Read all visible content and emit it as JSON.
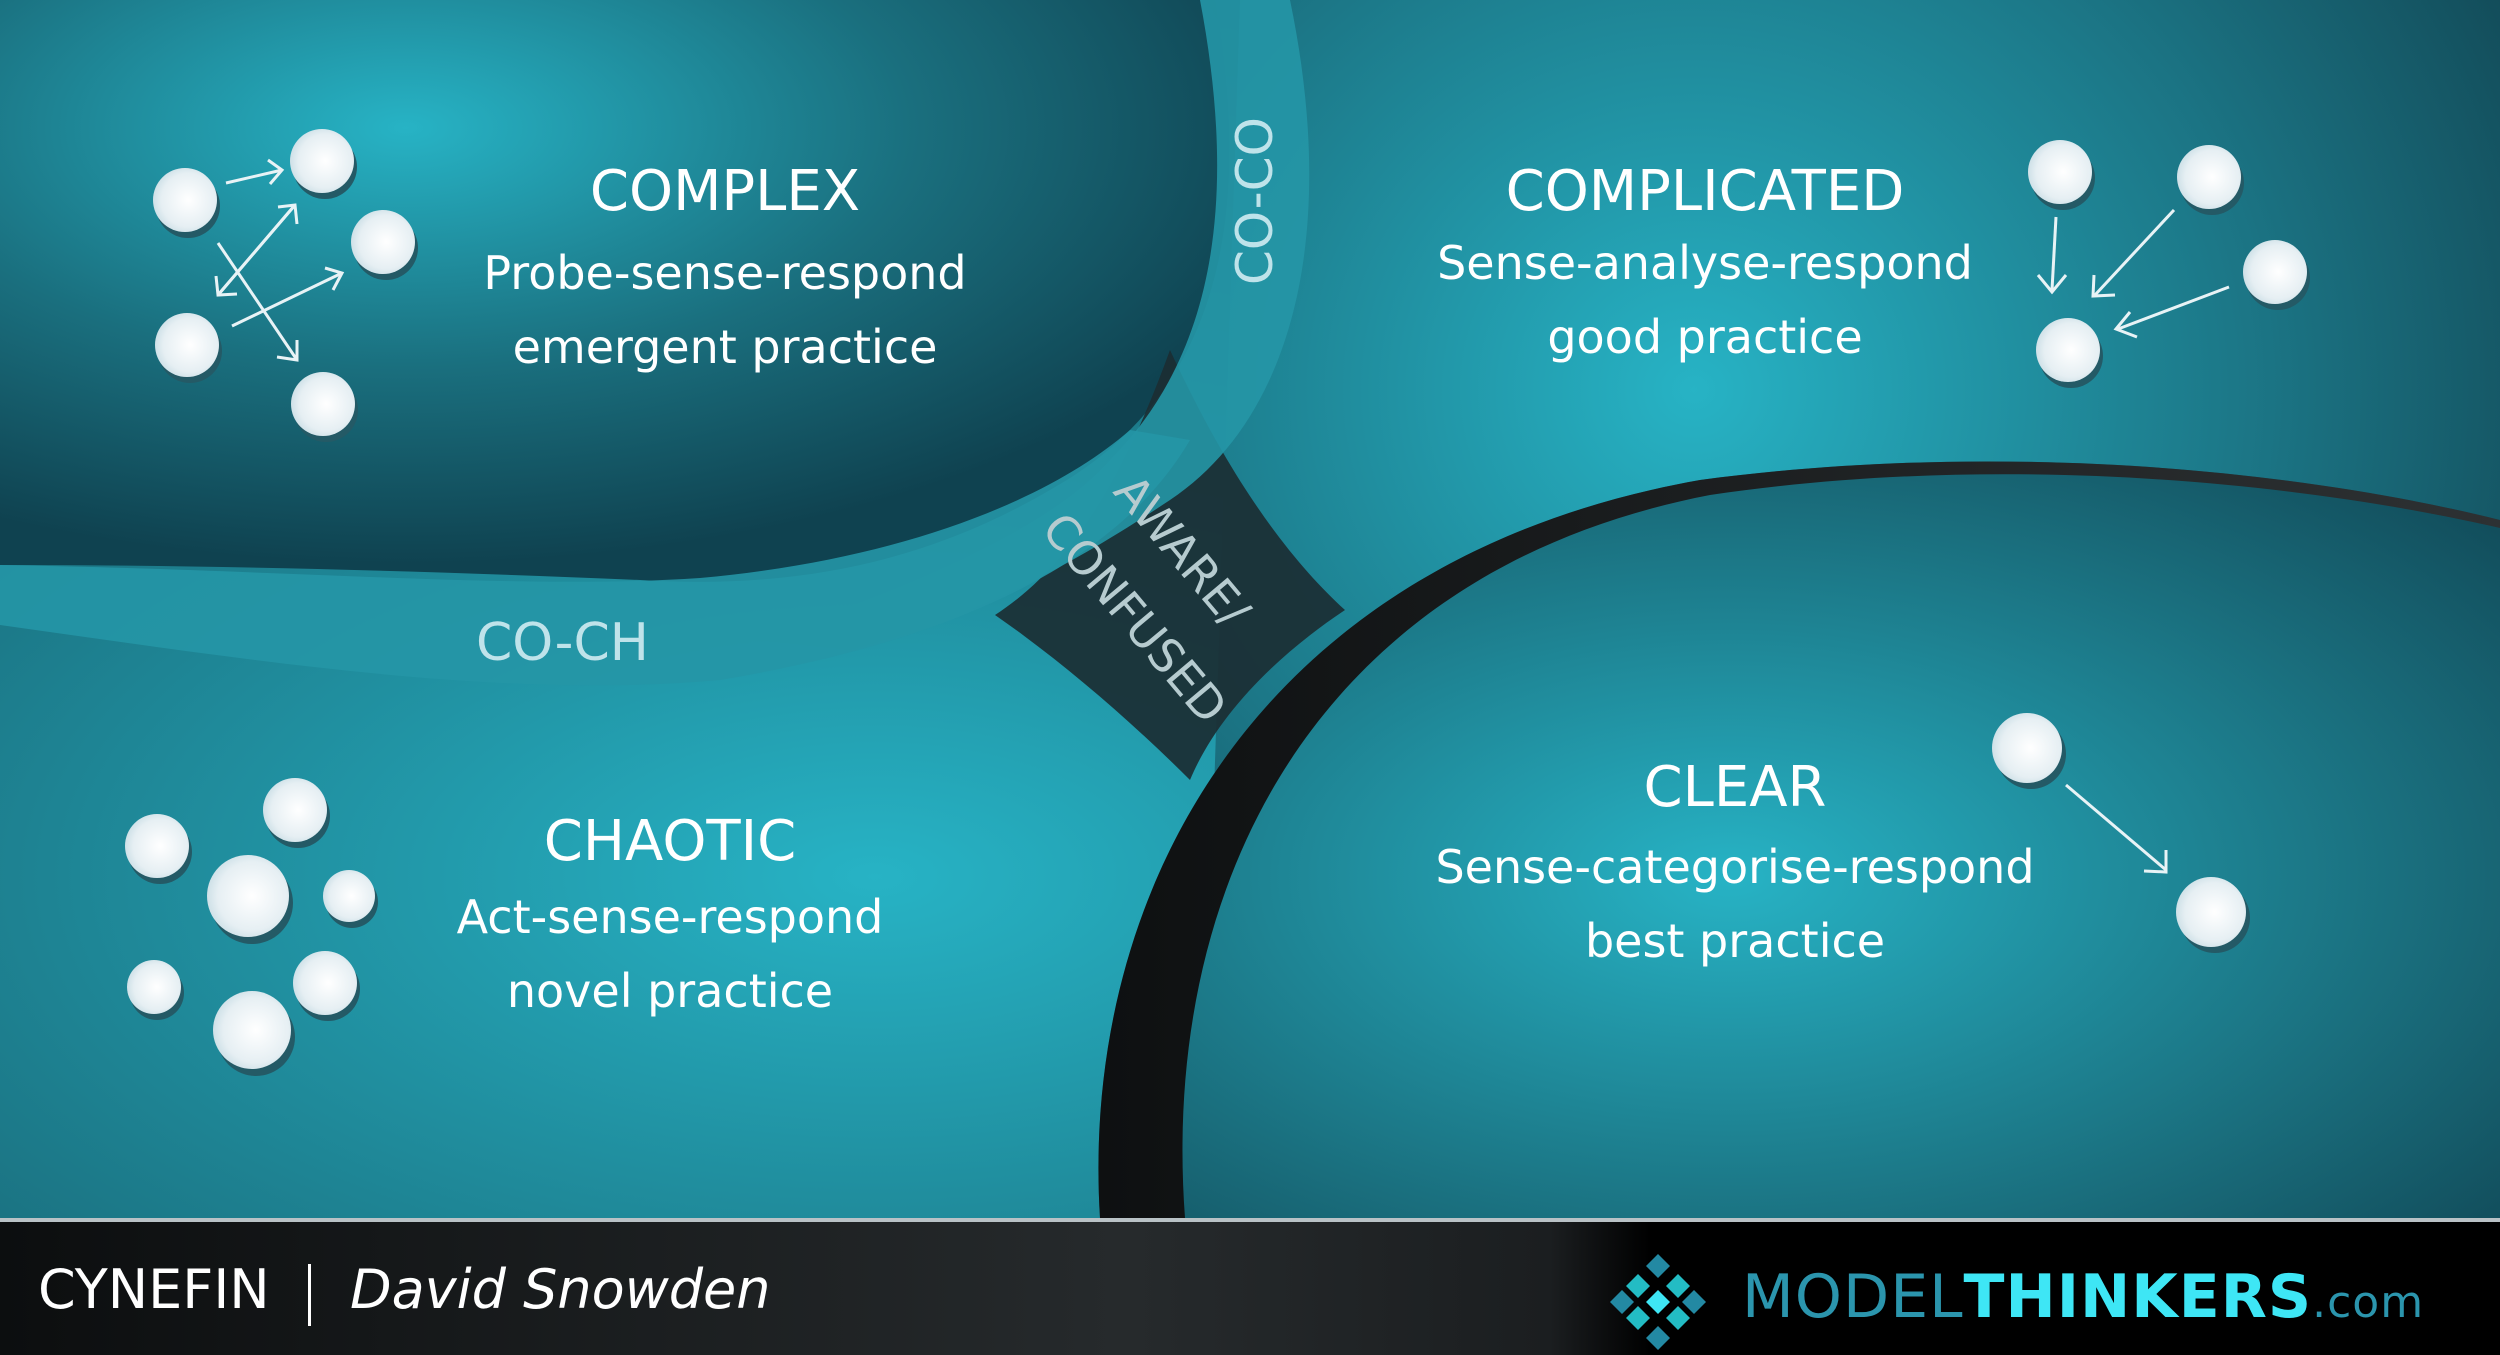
{
  "domains": {
    "complex": {
      "title": "COMPLEX",
      "approach": "Probe-sense-respond",
      "practice": "emergent practice"
    },
    "complicated": {
      "title": "COMPLICATED",
      "approach": "Sense-analyse-respond",
      "practice": "good practice"
    },
    "chaotic": {
      "title": "CHAOTIC",
      "approach": "Act-sense-respond",
      "practice": "novel practice"
    },
    "clear": {
      "title": "CLEAR",
      "approach": "Sense-categorise-respond",
      "practice": "best practice"
    }
  },
  "boundaries": {
    "co_co": "CO-CO",
    "co_ch": "CO-CH",
    "center_line1": "AWARE/",
    "center_line2": "CONFUSED"
  },
  "footer": {
    "title": "CYNEFIN",
    "separator": "|",
    "author": "David Snowden",
    "brand_part1": "MODEL",
    "brand_part2": "THINKERS",
    "brand_suffix": ".com"
  },
  "colors": {
    "teal_light": "#27b2c4",
    "teal_dark": "#0f3f4c",
    "band": "#2596a6",
    "brand_dark": "#2b95ad",
    "brand_bright": "#3ee6f5"
  }
}
